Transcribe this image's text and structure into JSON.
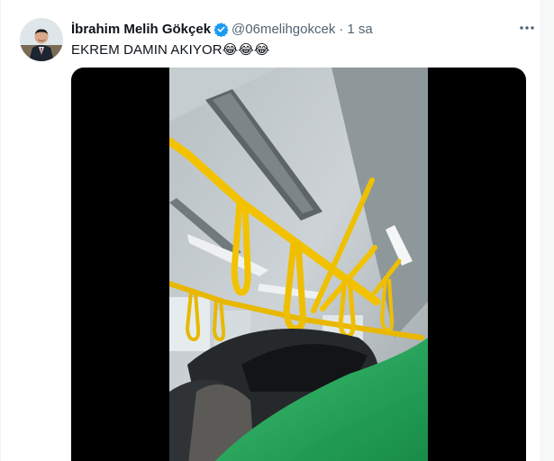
{
  "tweet": {
    "author_name": "İbrahim Melih Gökçek",
    "handle": "@06melihgokcek",
    "separator": "·",
    "time": "1 sa",
    "text": "EKREM DAMIN AKIYOR😂😂😂"
  },
  "icons": {
    "verified": "verified-badge-icon",
    "more": "more-options-icon"
  },
  "colors": {
    "verified_blue": "#1d9bf0",
    "handle_gray": "#536471",
    "grab_handle_yellow": "#f2c200",
    "umbrella_green": "#21a15a"
  }
}
